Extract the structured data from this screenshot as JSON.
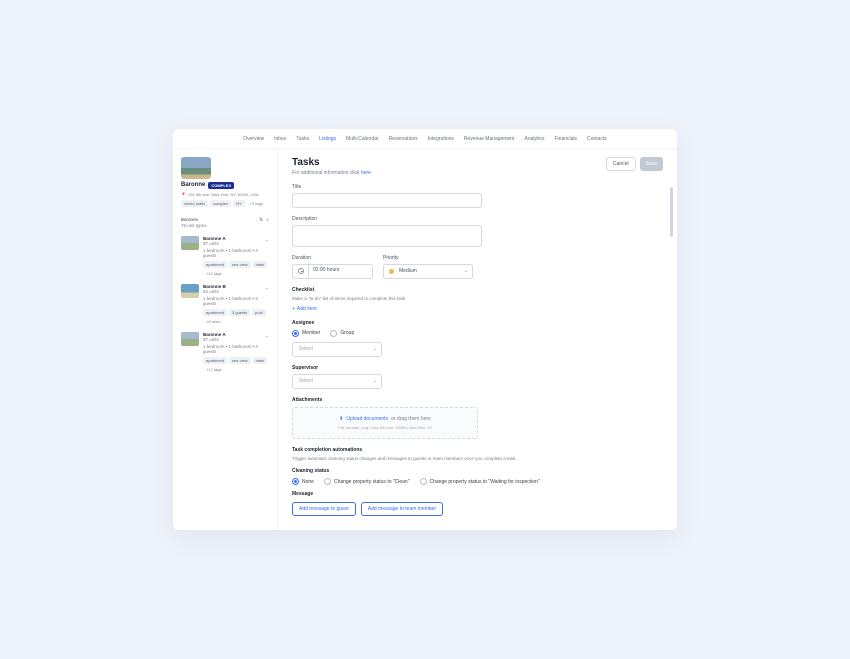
{
  "nav": {
    "items": [
      "Overview",
      "Inbox",
      "Tasks",
      "Listings",
      "Multi-Calendar",
      "Reservations",
      "Integrations",
      "Revenue Management",
      "Analytics",
      "Financials",
      "Contacts"
    ],
    "active_index": 3
  },
  "sidebar": {
    "property": {
      "name": "Baronne",
      "badge": "COMPLEX",
      "address": "131 5th Ave, New York, NY 10003, USA",
      "tags": [
        "zeeko mails",
        "complex",
        "NY"
      ],
      "more_tags": "+3 tags"
    },
    "header": {
      "name": "Baronne",
      "unit_count": "75 unit types"
    },
    "units": [
      {
        "name": "Baronne A",
        "sub": "97 units",
        "detail": "1 bedroom • 1 bathroom • 4 guests",
        "tags": [
          "apartment",
          "sea view",
          "main"
        ],
        "more": "+12 tags",
        "photo_class": ""
      },
      {
        "name": "Baronne B",
        "sub": "62 units",
        "detail": "1 bedroom • 1 bathroom • 2 guests",
        "tags": [
          "apartment",
          "3 guests",
          "pool"
        ],
        "more": "+6 more",
        "photo_class": "pool"
      },
      {
        "name": "Baronne A",
        "sub": "97 units",
        "detail": "1 bedroom • 1 bathroom • 4 guests",
        "tags": [
          "apartment",
          "sea view",
          "main"
        ],
        "more": "+17 tags",
        "photo_class": ""
      }
    ]
  },
  "main": {
    "title": "Tasks",
    "help_prefix": "For additional information click ",
    "help_link": "here",
    "actions": {
      "cancel": "Cancel",
      "save": "Save"
    },
    "fields": {
      "title_label": "Title",
      "desc_label": "Description",
      "duration_label": "Duration",
      "duration_value": "02:00 hours",
      "priority_label": "Priority",
      "priority_value": "Medium",
      "checklist_label": "Checklist",
      "checklist_help": "Make a \"to-do\" list of items required to complete this task",
      "add_item": "Add item",
      "assignee_label": "Assignee",
      "assignee_options": [
        "Member",
        "Group"
      ],
      "assignee_selected": 0,
      "assignee_placeholder": "Select",
      "supervisor_label": "Supervisor",
      "supervisor_placeholder": "Select",
      "attachments_label": "Attachments",
      "upload_link": "Upload documents",
      "upload_suffix": "or drag them here",
      "upload_sub": "File formats: png | Max file size: 20MB | Max files: 10",
      "automations_label": "Task completion automations",
      "automations_help": "Trigger automatic cleaning status changes and messages to guests or team members once you complete a task.",
      "cleaning_label": "Cleaning status",
      "cleaning_options": [
        "None",
        "Change property status to \"Clean\"",
        "Change property status to \"Waiting for inspection\""
      ],
      "cleaning_selected": 0,
      "message_label": "Message",
      "msg_guest": "Add message to guest",
      "msg_team": "Add message to team member"
    }
  }
}
